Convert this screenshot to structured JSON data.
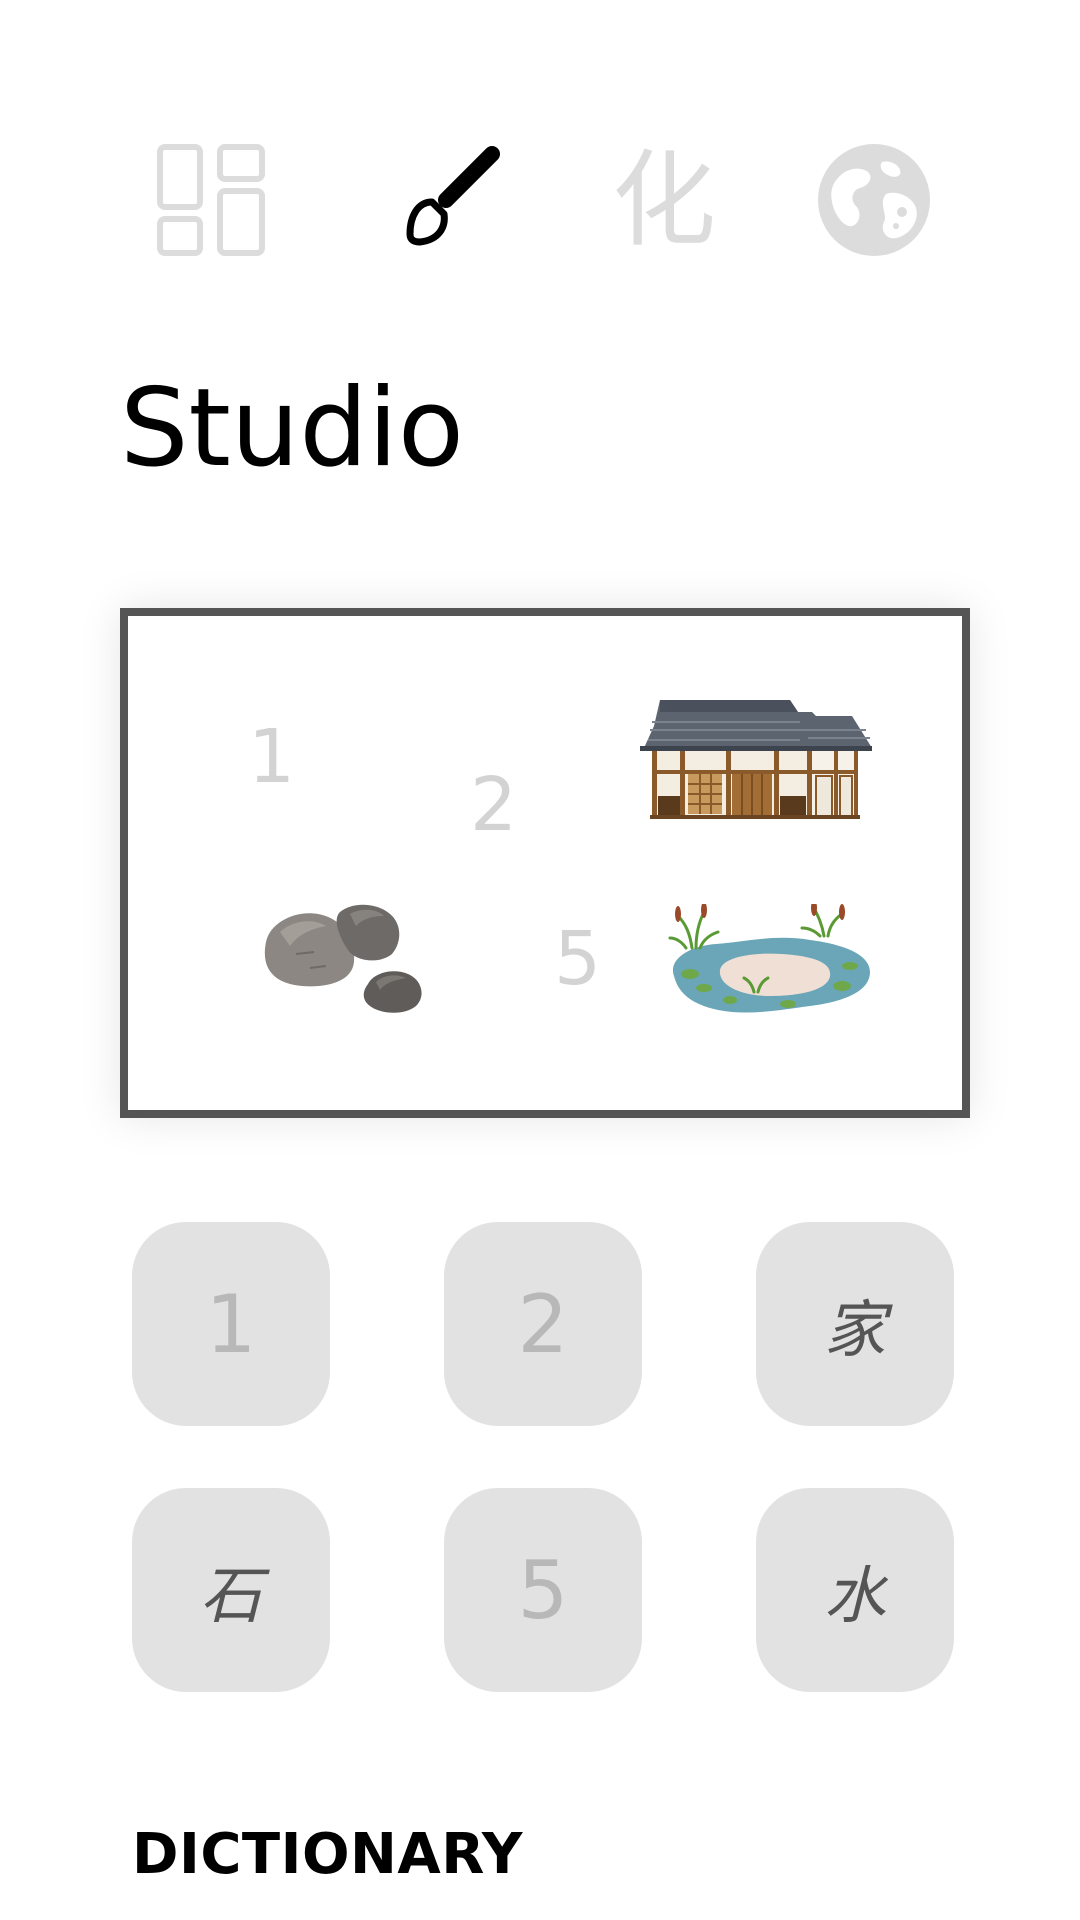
{
  "nav": {
    "items": [
      {
        "id": "dashboard",
        "icon": "dashboard-icon",
        "active": false
      },
      {
        "id": "studio",
        "icon": "brush-icon",
        "active": true
      },
      {
        "id": "transform",
        "icon": "kanji-icon",
        "glyph": "化",
        "active": false
      },
      {
        "id": "world",
        "icon": "globe-icon",
        "active": false
      }
    ],
    "active_color": "#000000",
    "inactive_color": "#dcdcdc"
  },
  "page": {
    "title": "Studio"
  },
  "canvas": {
    "slots": [
      {
        "position": 1,
        "label": "1",
        "filled": false
      },
      {
        "position": 2,
        "label": "2",
        "filled": false
      },
      {
        "position": 3,
        "filled": true,
        "art": "house-image"
      },
      {
        "position": 4,
        "filled": true,
        "art": "rocks-image"
      },
      {
        "position": 5,
        "label": "5",
        "filled": false
      },
      {
        "position": 6,
        "filled": true,
        "art": "pond-image"
      }
    ]
  },
  "tiles": [
    {
      "label": "1",
      "kind": "number"
    },
    {
      "label": "2",
      "kind": "number"
    },
    {
      "label": "家",
      "kind": "kanji"
    },
    {
      "label": "石",
      "kind": "kanji"
    },
    {
      "label": "5",
      "kind": "number"
    },
    {
      "label": "水",
      "kind": "kanji"
    }
  ],
  "dictionary": {
    "heading": "DICTIONARY"
  }
}
